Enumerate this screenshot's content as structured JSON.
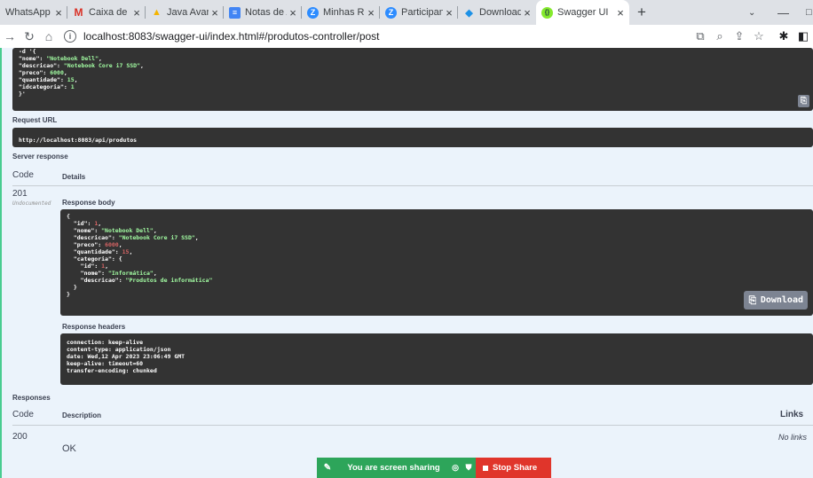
{
  "browser": {
    "tabs": [
      {
        "label": "WhatsApp",
        "icon": "whatsapp-icon",
        "color": "#25d366"
      },
      {
        "label": "Caixa de entr",
        "icon": "gmail-icon",
        "color": "#d93025"
      },
      {
        "label": "Java Avançad",
        "icon": "google-drive-icon",
        "color": "#f4b400"
      },
      {
        "label": "Notas de Aul",
        "icon": "google-docs-icon",
        "color": "#4285f4"
      },
      {
        "label": "Minhas Reuni",
        "icon": "zoom-icon",
        "color": "#2d8cff"
      },
      {
        "label": "Participante d",
        "icon": "zoom-icon",
        "color": "#2d8cff"
      },
      {
        "label": "Download Do",
        "icon": "docker-icon",
        "color": "#1d91e6"
      },
      {
        "label": "Swagger UI",
        "icon": "swagger-icon",
        "color": "#85ea2d"
      }
    ],
    "url": "localhost:8083/swagger-ui/index.html#/produtos-controller/post"
  },
  "curl": {
    "line1": "-d '{",
    "k1": "\"nome\"",
    "v1": "\"Notebook Dell\"",
    "k2": "\"descricao\"",
    "v2": "\"Notebook Core i7 SSD\"",
    "k3": "\"preco\"",
    "v3": "6000",
    "k4": "\"quantidade\"",
    "v4": "15",
    "k5": "\"idcategoria\"",
    "v5": "1",
    "end": "}'"
  },
  "request_url": {
    "label": "Request URL",
    "value": "http://localhost:8083/api/produtos"
  },
  "server_response": {
    "title": "Server response",
    "code_header": "Code",
    "details_header": "Details",
    "code": "201",
    "code_note": "Undocumented",
    "body_label": "Response body",
    "body": {
      "open": "{",
      "id_k": "\"id\"",
      "id_v": "1",
      "nome_k": "\"nome\"",
      "nome_v": "\"Notebook Dell\"",
      "desc_k": "\"descricao\"",
      "desc_v": "\"Notebook Core i7 SSD\"",
      "preco_k": "\"preco\"",
      "preco_v": "6000",
      "qtd_k": "\"quantidade\"",
      "qtd_v": "15",
      "cat_k": "\"categoria\"",
      "cat_open": "{",
      "cid_k": "\"id\"",
      "cid_v": "1",
      "cnome_k": "\"nome\"",
      "cnome_v": "\"Informática\"",
      "cdesc_k": "\"descricao\"",
      "cdesc_v": "\"Produtos de informática\"",
      "cat_close": "}",
      "close": "}"
    },
    "download_label": "Download",
    "headers_label": "Response headers",
    "headers": [
      "connection: keep-alive",
      "content-type: application/json",
      "date: Wed,12 Apr 2023 23:06:49 GMT",
      "keep-alive: timeout=60",
      "transfer-encoding: chunked"
    ]
  },
  "responses": {
    "title": "Responses",
    "code_header": "Code",
    "description_header": "Description",
    "links_header": "Links",
    "rows": [
      {
        "code": "200",
        "description": "OK",
        "links": "No links"
      }
    ]
  },
  "screen_share": {
    "status": "You are screen sharing",
    "stop_label": "Stop Share"
  }
}
